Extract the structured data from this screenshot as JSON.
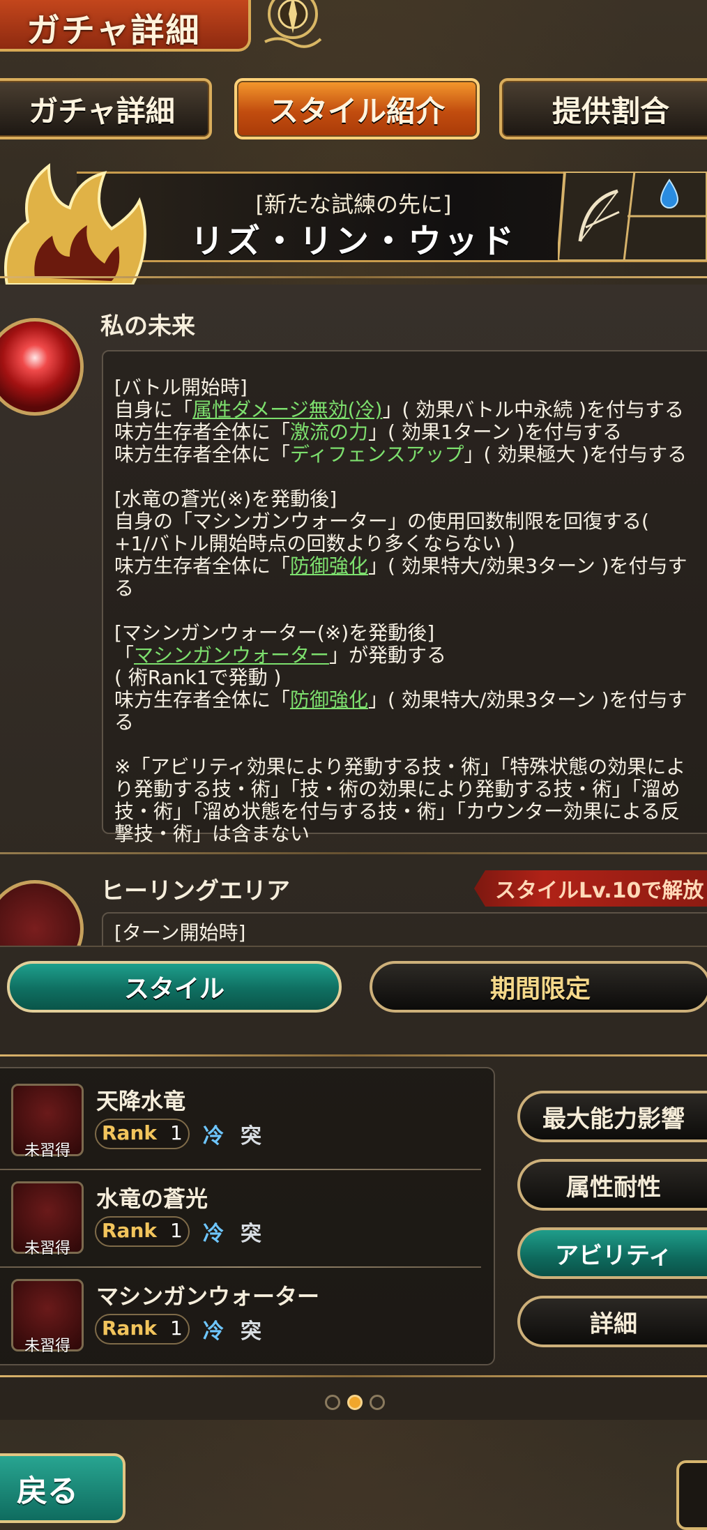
{
  "header": {
    "title": "ガチャ詳細"
  },
  "tabs": [
    {
      "label": "ガチャ詳細",
      "active": false
    },
    {
      "label": "スタイル紹介",
      "active": true
    },
    {
      "label": "提供割合",
      "active": false
    }
  ],
  "style": {
    "subtitle": "[新たな試練の先に]",
    "name": "リズ・リン・ウッド",
    "weapon_icon": "bow-icon",
    "element_icon": "water-drop-icon"
  },
  "ability1": {
    "name": "私の未来",
    "icon": "sparkle-flame-icon",
    "lines": [
      "[バトル開始時]",
      "自身に「属性ダメージ無効(冷)」( 効果バトル中永続 )を付与する",
      "味方生存者全体に「激流の力」( 効果1ターン )を付与する",
      "味方生存者全体に「ディフェンスアップ」( 効果極大 )を付与する",
      "",
      "[水竜の蒼光(※)を発動後]",
      "自身の「マシンガンウォーター」の使用回数制限を回復する(",
      "+1/バトル開始時点の回数より多くならない )",
      "味方生存者全体に「防御強化」( 効果特大/効果3ターン )を付与す",
      "る",
      "",
      "[マシンガンウォーター(※)を発動後]",
      "「マシンガンウォーター」が発動する",
      "( 術Rank1で発動 )",
      "味方生存者全体に「防御強化」( 効果特大/効果3ターン )を付与す",
      "る",
      "",
      "※「アビリティ効果により発動する技・術」「特殊状態の効果によ",
      "り発動する技・術」「技・術の効果により発動する技・術」「溜め",
      "技・術」「溜め状態を付与する技・術」「カウンター効果による反",
      "撃技・術」は含まない"
    ]
  },
  "ability2": {
    "name": "ヒーリングエリア",
    "unlock": "スタイルLv.10で解放",
    "first_line": "[ターン開始時]",
    "icon": "lock-icon"
  },
  "toggle": {
    "left": "スタイル",
    "right": "期間限定"
  },
  "skills": [
    {
      "name": "天降水竜",
      "status": "未習得",
      "rank_label": "Rank",
      "rank": "1",
      "elements": [
        "冷",
        "突"
      ]
    },
    {
      "name": "水竜の蒼光",
      "status": "未習得",
      "rank_label": "Rank",
      "rank": "1",
      "elements": [
        "冷",
        "突"
      ]
    },
    {
      "name": "マシンガンウォーター",
      "status": "未習得",
      "rank_label": "Rank",
      "rank": "1",
      "elements": [
        "冷",
        "突"
      ]
    }
  ],
  "side_buttons": [
    {
      "label": "最大能力影響",
      "active": false
    },
    {
      "label": "属性耐性",
      "active": false
    },
    {
      "label": "アビリティ",
      "active": true
    },
    {
      "label": "詳細",
      "active": false
    }
  ],
  "pagination": {
    "current": 2,
    "total": 3
  },
  "back_button": {
    "label": "戻る"
  },
  "colors": {
    "accent_teal": "#1e9f8c",
    "highlight_green": "#7de06e",
    "tab_orange": "#e07a22"
  }
}
